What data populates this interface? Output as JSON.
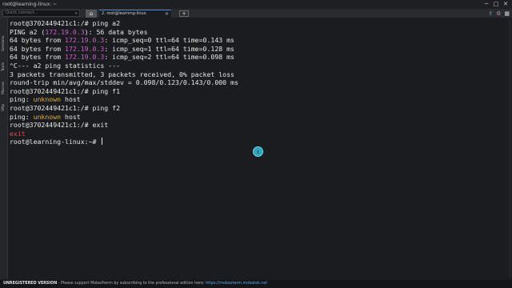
{
  "window": {
    "title": "root@learning-linux: ~",
    "controls": [
      "minimize-icon",
      "maximize-icon",
      "close-icon"
    ]
  },
  "tabbar": {
    "quick_connect_placeholder": "Quick connect...",
    "home_tab_icon": "home-icon",
    "active_tab_label": "2. root@learning-linux",
    "active_tab_close": "×",
    "new_tab_label": "+",
    "right_icons": [
      "upload-icon",
      "gear-icon",
      "grid-icon"
    ]
  },
  "sidebar": {
    "tabs": [
      "Sessions",
      "Tools",
      "Macros",
      "Sftp"
    ]
  },
  "terminal": {
    "lines": [
      [
        {
          "t": "root@3702449421c1:/# ping a2"
        }
      ],
      [
        {
          "t": "PING a2 ("
        },
        {
          "t": "172.19.0.3",
          "c": "ip"
        },
        {
          "t": "): 56 data bytes"
        }
      ],
      [
        {
          "t": "64 bytes from "
        },
        {
          "t": "172.19.0.3",
          "c": "ip"
        },
        {
          "t": ": icmp_seq=0 ttl=64 time=0.143 ms"
        }
      ],
      [
        {
          "t": "64 bytes from "
        },
        {
          "t": "172.19.0.3",
          "c": "ip"
        },
        {
          "t": ": icmp_seq=1 ttl=64 time=0.128 ms"
        }
      ],
      [
        {
          "t": "64 bytes from "
        },
        {
          "t": "172.19.0.3",
          "c": "ip"
        },
        {
          "t": ": icmp_seq=2 ttl=64 time=0.098 ms"
        }
      ],
      [
        {
          "t": "^C--- a2 ping statistics ---"
        }
      ],
      [
        {
          "t": "3 packets transmitted, 3 packets received, 0% packet loss"
        }
      ],
      [
        {
          "t": "round-trip min/avg/max/stddev = 0.098/0.123/0.143/0.000 ms"
        }
      ],
      [
        {
          "t": "root@3702449421c1:/# ping f1"
        }
      ],
      [
        {
          "t": "ping: "
        },
        {
          "t": "unknown",
          "c": "warn"
        },
        {
          "t": " host"
        }
      ],
      [
        {
          "t": "root@3702449421c1:/# ping f2"
        }
      ],
      [
        {
          "t": "ping: "
        },
        {
          "t": "unknown",
          "c": "warn"
        },
        {
          "t": " host"
        }
      ],
      [
        {
          "t": "root@3702449421c1:/# exit"
        }
      ],
      [
        {
          "t": "exit",
          "c": "exitc"
        }
      ],
      [
        {
          "t": "root@learning-linux:~# "
        }
      ]
    ]
  },
  "statusbar": {
    "edition": "UNREGISTERED VERSION",
    "message": " -  Please support MobaXterm by subscribing to the professional edition here: ",
    "url": "https://mobaxterm.mobatek.net"
  },
  "colors": {
    "ip": "#d05bd0",
    "warning": "#d6b43a",
    "exit": "#e04848",
    "accent": "#3b8edb"
  }
}
